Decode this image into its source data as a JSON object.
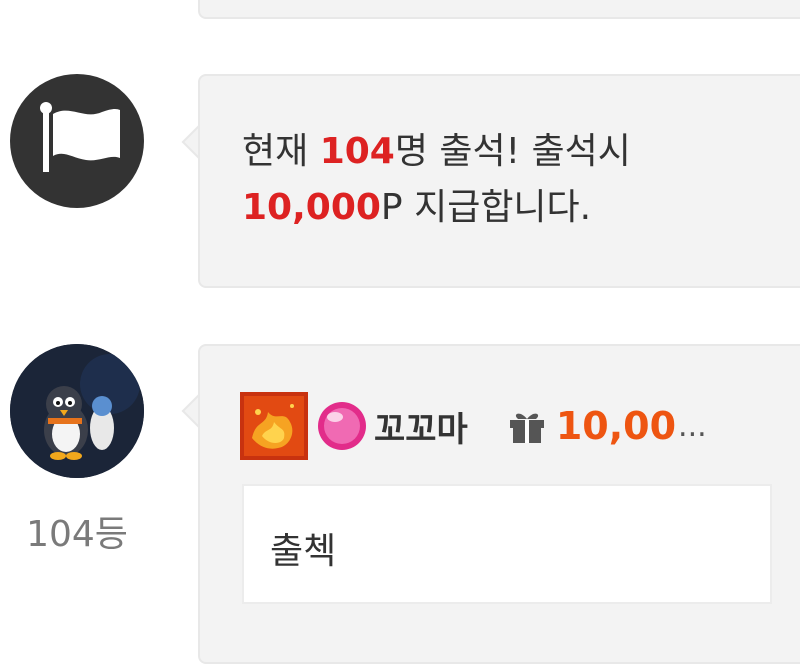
{
  "notice": {
    "prefix": "현재 ",
    "count": "104",
    "middle": "명 출석! 출석시",
    "points": "10,000",
    "suffix": "P 지급합니다."
  },
  "comment": {
    "rank": "104등",
    "username": "꼬꼬마",
    "points": "10,00",
    "points_ellipsis": "...",
    "text": "출첵"
  },
  "icons": {
    "notice_avatar": "flag-icon",
    "user_avatar": "penguin-avatar",
    "level_badge": "fire-badge-icon",
    "gem": "pink-gem-icon",
    "gift": "gift-icon"
  },
  "colors": {
    "highlight_red": "#dd2222",
    "points_orange": "#ee5511",
    "bubble_bg": "#f3f3f3"
  }
}
